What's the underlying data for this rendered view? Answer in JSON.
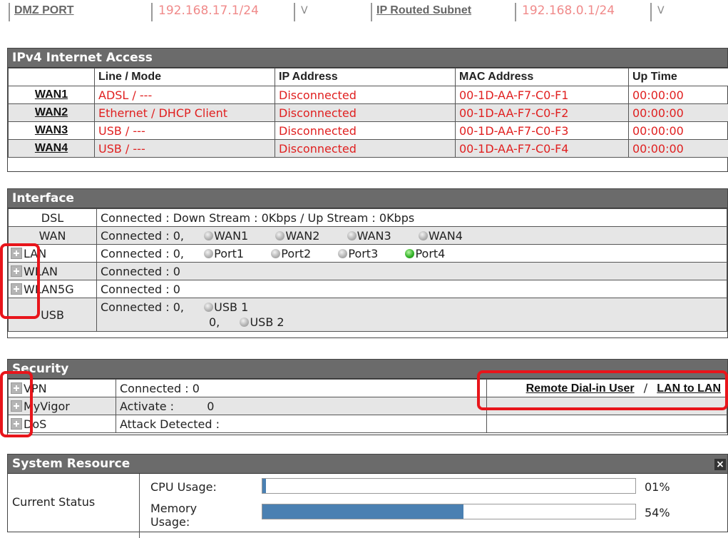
{
  "top_strip": {
    "dmz_label": "DMZ PORT",
    "dmz_ip": "192.168.17.1/24",
    "dmz_v": "V",
    "routed_label": "IP Routed Subnet",
    "routed_ip": "192.168.0.1/24",
    "routed_v": "V"
  },
  "ipv4": {
    "title": "IPv4 Internet Access",
    "headers": [
      "",
      "Line / Mode",
      "IP Address",
      "MAC Address",
      "Up Time"
    ],
    "rows": [
      {
        "name": "WAN1",
        "mode": "ADSL / ---",
        "ip": "Disconnected",
        "mac": "00-1D-AA-F7-C0-F1",
        "uptime": "00:00:00"
      },
      {
        "name": "WAN2",
        "mode": "Ethernet / DHCP Client",
        "ip": "Disconnected",
        "mac": "00-1D-AA-F7-C0-F2",
        "uptime": "00:00:00"
      },
      {
        "name": "WAN3",
        "mode": "USB / ---",
        "ip": "Disconnected",
        "mac": "00-1D-AA-F7-C0-F3",
        "uptime": "00:00:00"
      },
      {
        "name": "WAN4",
        "mode": "USB / ---",
        "ip": "Disconnected",
        "mac": "00-1D-AA-F7-C0-F4",
        "uptime": "00:00:00"
      }
    ]
  },
  "interface": {
    "title": "Interface",
    "dsl": {
      "label": "DSL",
      "text": "Connected : Down Stream : 0Kbps / Up Stream : 0Kbps"
    },
    "wan": {
      "label": "WAN",
      "connected": "Connected :  0,",
      "ports": [
        "WAN1",
        "WAN2",
        "WAN3",
        "WAN4"
      ]
    },
    "lan": {
      "label": "LAN",
      "connected": "Connected :  0,",
      "ports": [
        "Port1",
        "Port2",
        "Port3",
        "Port4"
      ],
      "active_port": "Port4"
    },
    "wlan": {
      "label": "WLAN",
      "connected": "Connected :  0"
    },
    "wlan5g": {
      "label": "WLAN5G",
      "connected": "Connected :  0"
    },
    "usb": {
      "label": "USB",
      "connected": "Connected :  0,",
      "count2": "0,",
      "ports": [
        "USB 1",
        "USB 2"
      ]
    }
  },
  "security": {
    "title": "Security",
    "vpn": {
      "label": "VPN",
      "text": "Connected : 0",
      "link1": "Remote Dial-in User",
      "sep": "/",
      "link2": "LAN to LAN"
    },
    "myvigor": {
      "label": "MyVigor",
      "text": "Activate :",
      "value": "0"
    },
    "dos": {
      "label": "DoS",
      "text": "Attack Detected :"
    }
  },
  "system": {
    "title": "System Resource",
    "close": "×",
    "status_label": "Current Status",
    "cpu_label": "CPU Usage:",
    "cpu_value": "01%",
    "cpu_fraction": 0.01,
    "mem_label": "Memory Usage:",
    "mem_value": "54%",
    "mem_fraction": 0.54
  },
  "colors": {
    "header_bg": "#6b6b6b",
    "status_red": "#e02020",
    "highlight_box": "#e8151b",
    "bar_fill": "#4a80b2",
    "port_active": "#35b52a"
  }
}
